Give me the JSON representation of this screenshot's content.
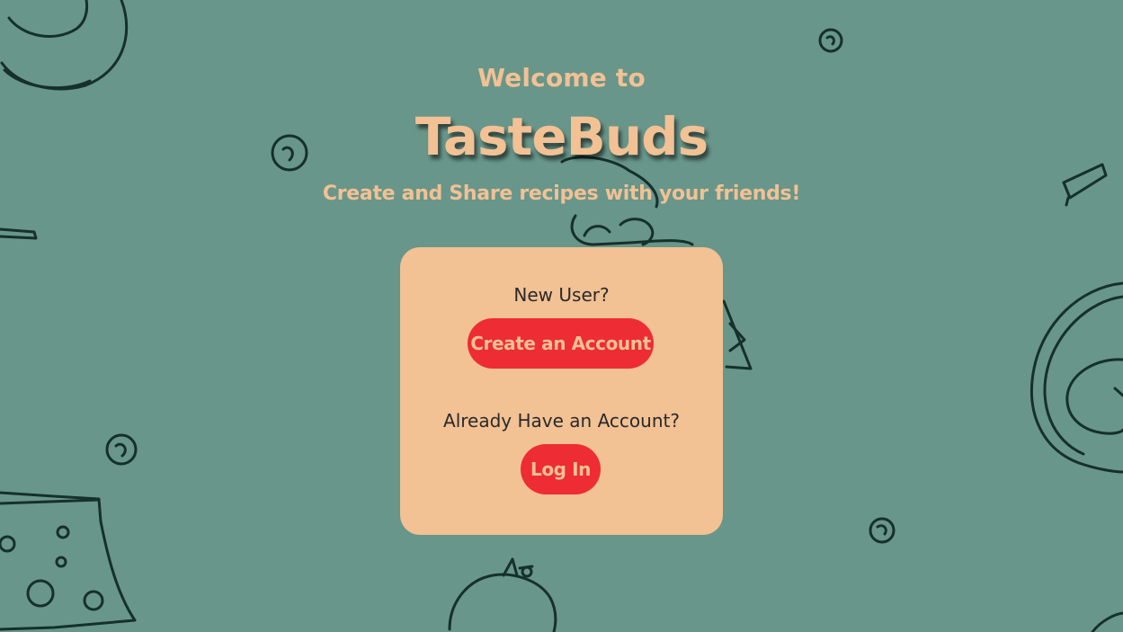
{
  "hero": {
    "welcome": "Welcome to",
    "brand": "TasteBuds",
    "tagline": "Create and Share recipes with your friends!"
  },
  "card": {
    "new_user_prompt": "New User?",
    "create_button": "Create an Account",
    "existing_user_prompt": "Already Have an Account?",
    "login_button": "Log In"
  },
  "colors": {
    "background": "#68968a",
    "accent_text": "#f2c194",
    "card": "#f2c194",
    "button": "#ee2c34",
    "doodle_stroke": "#16302c"
  },
  "background_icons": [
    "donut-icon",
    "pea-icon",
    "cheese-icon",
    "fried-egg-icon",
    "broccoli-icon",
    "tomato-icon",
    "stick-icon"
  ]
}
